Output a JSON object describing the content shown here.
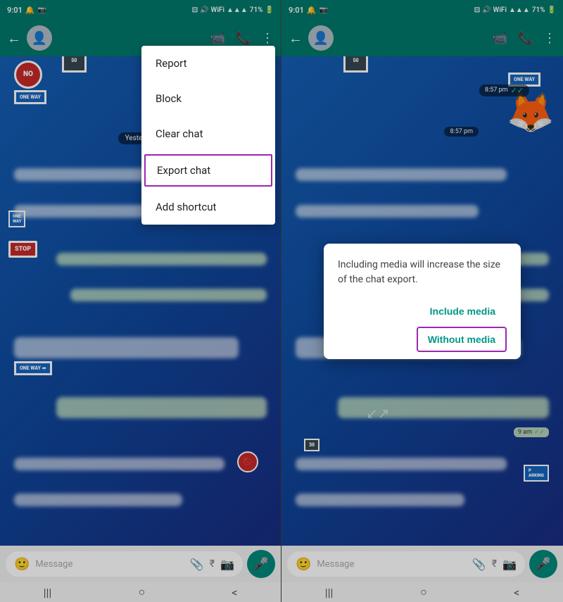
{
  "left_panel": {
    "status_bar": {
      "time": "9:01",
      "icons_left": [
        "notification",
        "camera",
        "gallery"
      ],
      "icons_right": [
        "cast",
        "volume",
        "wifi",
        "signal",
        "battery"
      ],
      "battery_text": "71%"
    },
    "app_bar": {
      "back_label": "←",
      "contact_name": "",
      "actions": [
        "video",
        "phone",
        "more"
      ]
    },
    "menu": {
      "items": [
        {
          "id": "report",
          "label": "Report",
          "highlighted": false
        },
        {
          "id": "block",
          "label": "Block",
          "highlighted": false
        },
        {
          "id": "clear-chat",
          "label": "Clear chat",
          "highlighted": false
        },
        {
          "id": "export-chat",
          "label": "Export chat",
          "highlighted": true
        },
        {
          "id": "add-shortcut",
          "label": "Add shortcut",
          "highlighted": false
        }
      ]
    },
    "chat": {
      "date_badge": "Yesterday",
      "message_placeholder": "Message"
    },
    "nav": {
      "items": [
        "|||",
        "○",
        "<"
      ]
    }
  },
  "right_panel": {
    "status_bar": {
      "time": "9:01",
      "battery_text": "71%"
    },
    "app_bar": {
      "back_label": "←"
    },
    "dialog": {
      "text": "Including media will increase the size of the chat export.",
      "include_media_label": "Include media",
      "without_media_label": "Without media",
      "without_media_highlighted": true
    },
    "chat": {
      "time_badge_1": "8:57 pm",
      "time_badge_2": "9 am",
      "message_placeholder": "Message"
    },
    "nav": {
      "items": [
        "|||",
        "○",
        "<"
      ]
    }
  }
}
